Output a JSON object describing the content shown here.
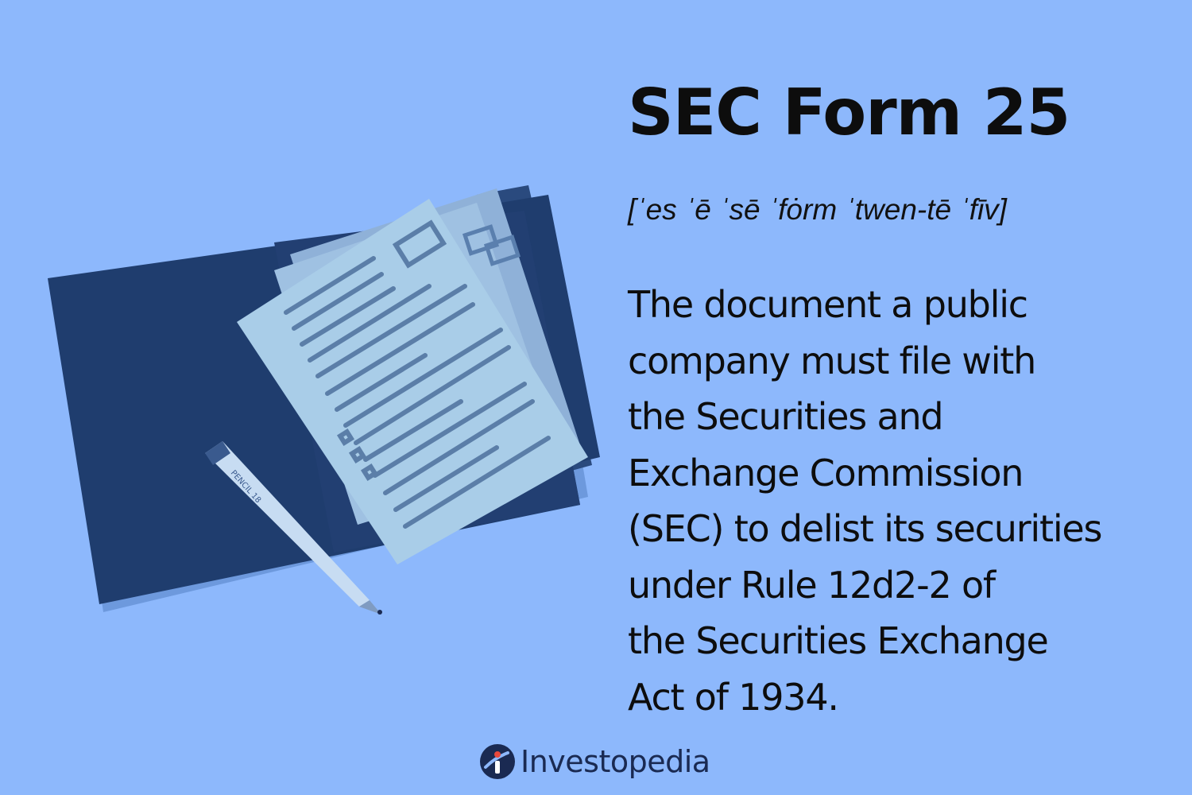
{
  "term": {
    "title": "SEC Form 25",
    "pronunciation": "[ˈes ˈē ˈsē ˈfȯrm ˈtwen-tē ˈfīv]"
  },
  "definition": {
    "lines": [
      "The document a public",
      "company must file with",
      "the Securities and",
      "Exchange Commission",
      "(SEC) to delist its securities",
      "under Rule 12d2-2 of",
      "the Securities Exchange",
      "Act of 1934."
    ]
  },
  "illustration": {
    "pencil_label": "PENCIL 18"
  },
  "brand": {
    "name": "Investopedia",
    "icon": "investopedia-logo-icon"
  },
  "colors": {
    "background": "#8db8fc",
    "folder": "#1f3d6e",
    "paper": "#a9cde8",
    "text": "#0d0d0d",
    "brand_dot": "#e8483b"
  }
}
